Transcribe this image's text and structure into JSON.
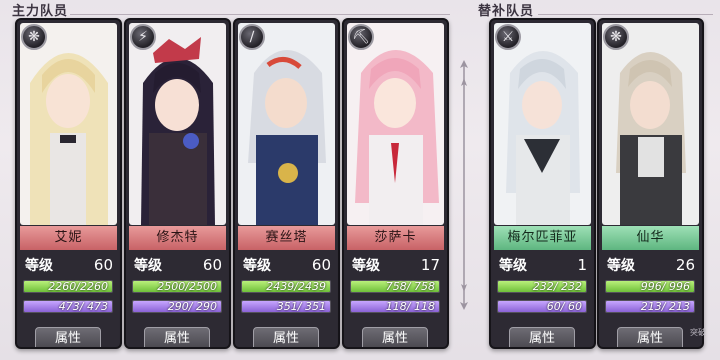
{
  "sections": {
    "main_team": "主力队员",
    "reserve_team": "替补队员"
  },
  "colors": {
    "hp_fill": "#8fd85a",
    "mp_fill": "#a47ef0",
    "main_nameplate": "#d77b7e",
    "reserve_nameplate": "#7ccb98"
  },
  "level_label": "等级",
  "attribute_button_label": "属性",
  "corner_text": "突破",
  "characters": [
    {
      "name": "艾妮",
      "icon": "spiral-ornament-icon",
      "level": "60",
      "hp_current": "2260",
      "hp_max": "2260",
      "mp_current": "473",
      "mp_max": "473",
      "hp_ratio": 1.0,
      "mp_ratio": 1.0
    },
    {
      "name": "修杰特",
      "icon": "staff-icon",
      "level": "60",
      "hp_current": "2500",
      "hp_max": "2500",
      "mp_current": "290",
      "mp_max": "290",
      "hp_ratio": 1.0,
      "mp_ratio": 1.0
    },
    {
      "name": "赛丝塔",
      "icon": "pole-icon",
      "level": "60",
      "hp_current": "2439",
      "hp_max": "2439",
      "mp_current": "351",
      "mp_max": "351",
      "hp_ratio": 1.0,
      "mp_ratio": 1.0
    },
    {
      "name": "莎萨卡",
      "icon": "axe-icon",
      "level": "17",
      "hp_current": "758",
      "hp_max": "758",
      "mp_current": "118",
      "mp_max": "118",
      "hp_ratio": 1.0,
      "mp_ratio": 1.0
    },
    {
      "name": "梅尔匹菲亚",
      "icon": "sword-icon",
      "level": "1",
      "hp_current": "232",
      "hp_max": "232",
      "mp_current": "60",
      "mp_max": "60",
      "hp_ratio": 1.0,
      "mp_ratio": 1.0
    },
    {
      "name": "仙华",
      "icon": "spiral-ornament-icon",
      "level": "26",
      "hp_current": "996",
      "hp_max": "996",
      "mp_current": "213",
      "mp_max": "213",
      "hp_ratio": 1.0,
      "mp_ratio": 1.0
    }
  ]
}
